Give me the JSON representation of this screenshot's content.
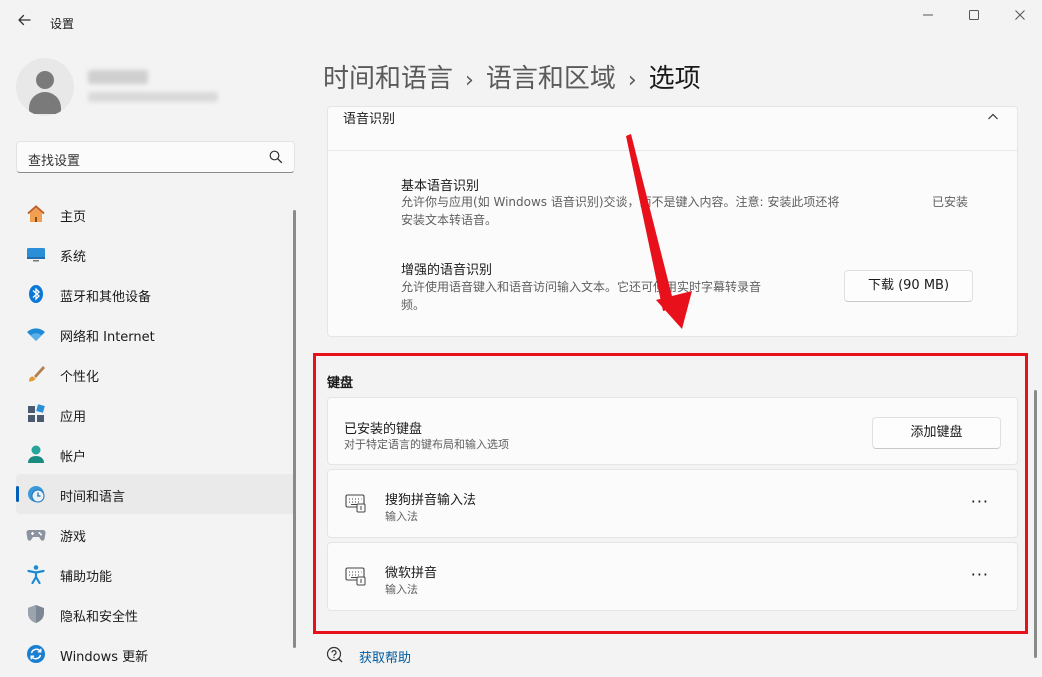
{
  "window": {
    "title": "设置",
    "back_icon": "arrow-left-icon"
  },
  "search": {
    "placeholder": "查找设置"
  },
  "sidebar": {
    "items": [
      {
        "label": "主页",
        "icon": "home-icon",
        "active": false
      },
      {
        "label": "系统",
        "icon": "monitor-icon",
        "active": false
      },
      {
        "label": "蓝牙和其他设备",
        "icon": "bluetooth-icon",
        "active": false
      },
      {
        "label": "网络和 Internet",
        "icon": "wifi-icon",
        "active": false
      },
      {
        "label": "个性化",
        "icon": "brush-icon",
        "active": false
      },
      {
        "label": "应用",
        "icon": "apps-icon",
        "active": false
      },
      {
        "label": "帐户",
        "icon": "account-icon",
        "active": false
      },
      {
        "label": "时间和语言",
        "icon": "time-language-icon",
        "active": true
      },
      {
        "label": "游戏",
        "icon": "gamepad-icon",
        "active": false
      },
      {
        "label": "辅助功能",
        "icon": "accessibility-icon",
        "active": false
      },
      {
        "label": "隐私和安全性",
        "icon": "shield-icon",
        "active": false
      },
      {
        "label": "Windows 更新",
        "icon": "windows-update-icon",
        "active": false
      }
    ]
  },
  "breadcrumb": {
    "part1": "时间和语言",
    "sep": "›",
    "part2": "语言和区域",
    "current": "选项"
  },
  "speech": {
    "title": "语音识别",
    "basic": {
      "title": "基本语音识别",
      "desc_line1": "允许你与应用(如 Windows 语音识别)交谈，而不是键入内容。注意: 安装此项还将",
      "desc_line2": "安装文本转语音。",
      "status": "已安装"
    },
    "enhanced": {
      "title": "增强的语音识别",
      "desc_line1": "允许使用语音键入和语音访问输入文本。它还可使用实时字幕转录音",
      "desc_line2": "频。",
      "button": "下载 (90 MB)"
    }
  },
  "keyboard": {
    "section_title": "键盘",
    "installed": {
      "title": "已安装的键盘",
      "subtitle": "对于特定语言的键布局和输入选项",
      "add_button": "添加键盘"
    },
    "items": [
      {
        "name": "搜狗拼音输入法",
        "type": "输入法",
        "more": "···"
      },
      {
        "name": "微软拼音",
        "type": "输入法",
        "more": "···"
      }
    ]
  },
  "help": {
    "label": "获取帮助"
  },
  "annotation": {
    "highlight_color": "#e8101a"
  },
  "colors": {
    "accent": "#005fb8",
    "link": "#005a9e"
  }
}
